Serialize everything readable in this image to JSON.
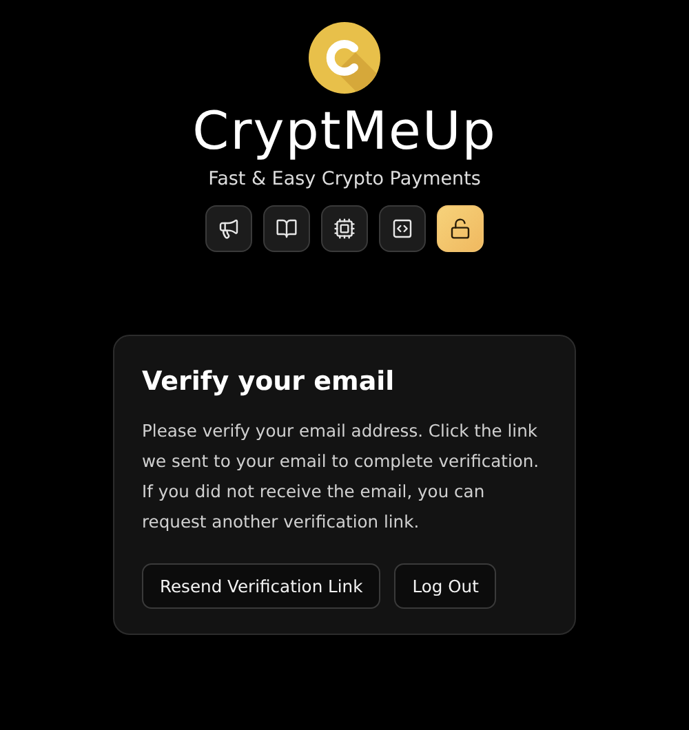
{
  "brand": {
    "name": "CryptMeUp",
    "tagline": "Fast & Easy Crypto Payments"
  },
  "nav": [
    {
      "selected": false
    },
    {
      "selected": false
    },
    {
      "selected": false
    },
    {
      "selected": false
    },
    {
      "selected": true
    }
  ],
  "card": {
    "title": "Verify your email",
    "message": "Please verify your email address. Click the link we sent to your email to complete verification. If you did not receive the email, you can request another verification link.",
    "buttons": [
      "Resend Verification Link",
      "Log Out"
    ]
  }
}
